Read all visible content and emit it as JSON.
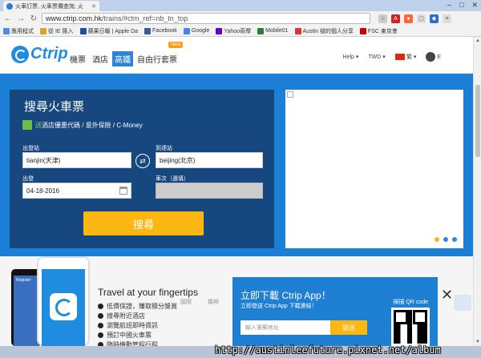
{
  "browser": {
    "tab_title": "火車訂票, 火車票價查詢, 火",
    "url_host": "www.ctrip.com.hk",
    "url_path": "/trains/#ctm_ref=nb_tn_top",
    "bookmarks": [
      {
        "label": "應用程式",
        "color": "#4a90e2"
      },
      {
        "label": "從 IE 匯入",
        "color": "#e0a030"
      },
      {
        "label": "蘋果日報 | Apple Da",
        "color": "#1b4fa0"
      },
      {
        "label": "Facebook",
        "color": "#3b5998"
      },
      {
        "label": "Google",
        "color": "#4285f4"
      },
      {
        "label": "Yahoo奇摩",
        "color": "#5f01d1"
      },
      {
        "label": "Mobile01",
        "color": "#2b7a3d"
      },
      {
        "label": "Austin 褪的個人分享",
        "color": "#d33"
      },
      {
        "label": "FSC 東京會",
        "color": "#c00"
      }
    ]
  },
  "header": {
    "logo_text": "Ctrip",
    "nav": [
      "機票",
      "酒店",
      "高鐵",
      "自由行套票"
    ],
    "active_nav": "高鐵",
    "new_badge": "New",
    "help": "Help",
    "currency": "TWD",
    "lang": "繁",
    "user": "E"
  },
  "search": {
    "title": "搜尋火車票",
    "promo_prefix": "送",
    "promo_text": "酒店優惠代碼 / 意外保險 / C-Money",
    "from_label": "出發站",
    "from_value": "tianjin(天津)",
    "to_label": "到達站",
    "to_value": "beijing(北京)",
    "date_label": "出發",
    "date_value": "04-18-2016",
    "train_label": "車次（選填）",
    "train_value": "",
    "submit": "搜尋"
  },
  "promo_app": {
    "phone_title": "Register",
    "headline": "Travel at your fingertips",
    "features": [
      "低價保證，賺取積分獎賞",
      "搜尋附近酒店",
      "瀏覽航班即時資訊",
      "預訂中國火車票",
      "臨時機動管程行程"
    ],
    "faded_tabs": [
      "國際",
      "攜帶"
    ],
    "download_title": "立即下載 Ctrip App！",
    "download_sub": "立即發送 Ctrip App 下載連結！",
    "qr_label": "掃描 QR code",
    "phone_placeholder": "輸入電郵地址",
    "send": "發送"
  },
  "watermark": "http://austinleefuture.pixnet.net/album"
}
